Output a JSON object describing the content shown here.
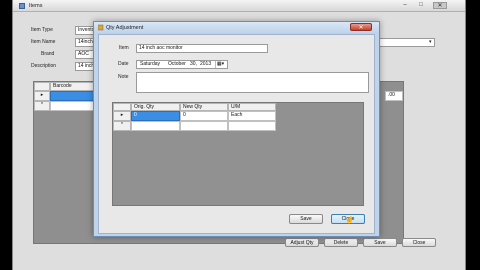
{
  "main_window": {
    "title": "Items",
    "controls": {
      "minimize": "–",
      "maximize": "□",
      "close": "✕"
    },
    "labels": {
      "item_type": "Item Type",
      "item_name": "Item Name",
      "brand": "Brand",
      "description": "Description"
    },
    "values": {
      "item_type": "Inventor",
      "item_name": "14inch",
      "brand": "AOC",
      "description": "14 inch"
    },
    "grid": {
      "column_barcode": "Barcode",
      "right_value": ".00",
      "row_markers": [
        "▸",
        "*"
      ]
    },
    "buttons": {
      "adjust_qty": "Adjust Qty",
      "delete": "Delete",
      "save": "Save",
      "close": "Close"
    }
  },
  "dialog": {
    "title": "Qty Adjustment",
    "close_glyph": "✕",
    "labels": {
      "item": "Item",
      "date": "Date",
      "note": "Note"
    },
    "item_value": "14 inch aoc monitor",
    "date": {
      "day": "Saturday",
      "month": "October",
      "daynum": "30,",
      "year": "2013"
    },
    "grid": {
      "columns": [
        "Orig. Qty",
        "New Qty",
        "U/M"
      ],
      "row_markers": [
        "▸",
        "*"
      ],
      "rows": [
        {
          "orig_qty": "0",
          "new_qty": "0",
          "um": "Each"
        }
      ]
    },
    "buttons": {
      "save": "Save",
      "close": "Close"
    }
  }
}
